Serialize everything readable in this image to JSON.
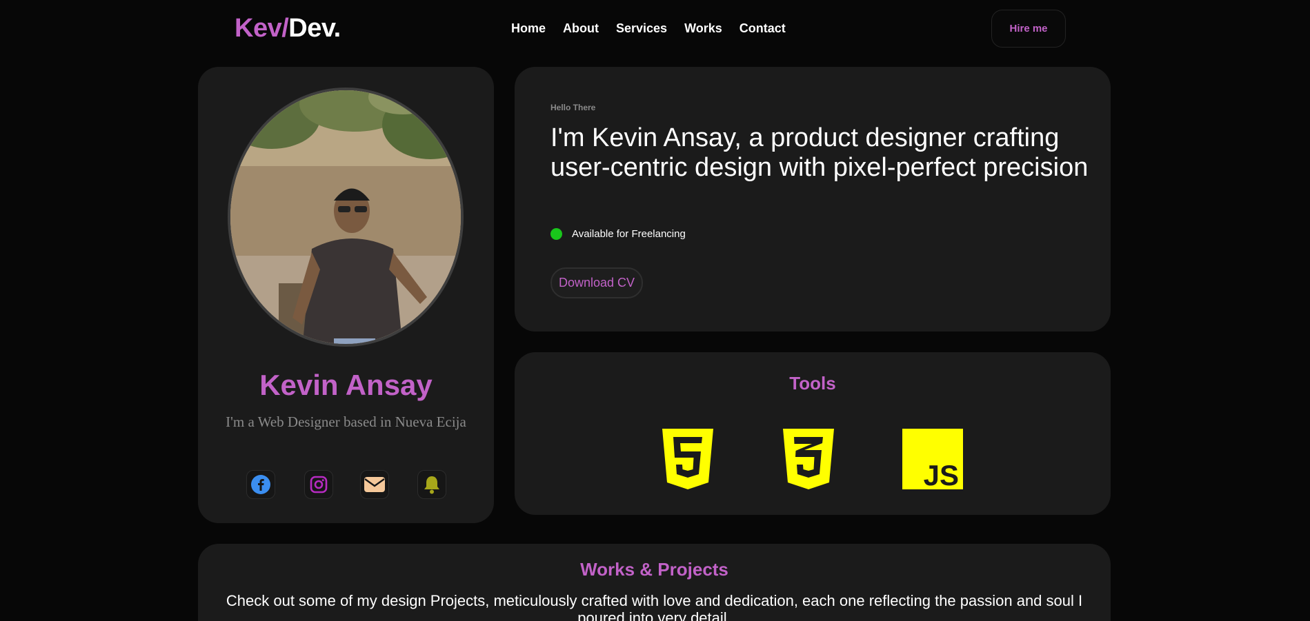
{
  "logo": {
    "part1": "Kev/",
    "part2": "Dev."
  },
  "nav": {
    "items": [
      "Home",
      "About",
      "Services",
      "Works",
      "Contact"
    ]
  },
  "hire_label": "Hire me",
  "profile": {
    "name": "Kevin Ansay",
    "bio": "I'm a Web Designer based in Nueva Ecija",
    "socials": [
      "facebook-icon",
      "instagram-icon",
      "mail-icon",
      "bell-icon"
    ]
  },
  "hero": {
    "eyebrow": "Hello There",
    "headline": "I'm Kevin Ansay, a product designer crafting user-centric design with pixel-perfect precision",
    "availability": "Available for Freelancing",
    "download_label": "Download CV"
  },
  "tools": {
    "title": "Tools",
    "items": [
      "html5-icon",
      "css3-icon",
      "javascript-icon"
    ]
  },
  "works": {
    "title": "Works & Projects",
    "description": "Check out some of my design Projects, meticulously crafted with love and dedication, each one reflecting the passion and soul I poured into very detail."
  },
  "colors": {
    "accent": "#c262c8",
    "card": "#1b1b1b",
    "background": "#070707",
    "status": "#19c61b"
  }
}
